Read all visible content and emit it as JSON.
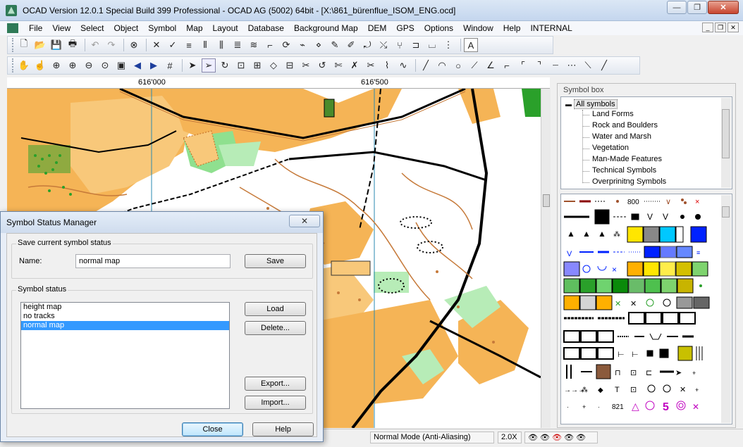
{
  "window": {
    "title": "OCAD Version 12.0.1  Special Build 399  Professional - OCAD AG (5002) 64bit - [X:\\861_bürenflue_ISOM_ENG.ocd]",
    "min_label": "—",
    "max_label": "❐",
    "close_label": "✕"
  },
  "menu": [
    "File",
    "View",
    "Select",
    "Object",
    "Symbol",
    "Map",
    "Layout",
    "Database",
    "Background Map",
    "DEM",
    "GPS",
    "Options",
    "Window",
    "Help",
    "INTERNAL"
  ],
  "ruler": {
    "labels": [
      "616'000",
      "616'500"
    ]
  },
  "symbol_box": {
    "title": "Symbol box",
    "tree_root": "All symbols",
    "tree_children": [
      "Land Forms",
      "Rock and Boulders",
      "Water and Marsh",
      "Vegetation",
      "Man-Made Features",
      "Technical Symbols",
      "Overprinitng Symbols"
    ],
    "palette_text": [
      "800",
      "821",
      "5"
    ]
  },
  "dialog": {
    "title": "Symbol Status Manager",
    "close_label": "✕",
    "save_group": "Save current symbol status",
    "name_label": "Name:",
    "name_value": "normal map",
    "save_button": "Save",
    "status_group": "Symbol status",
    "status_items": [
      "height map",
      "no tracks",
      "normal map"
    ],
    "selected_index": 2,
    "load_button": "Load",
    "delete_button": "Delete...",
    "export_button": "Export...",
    "import_button": "Import...",
    "close_button": "Close",
    "help_button": "Help"
  },
  "status": {
    "mode": "Normal Mode (Anti-Aliasing)",
    "zoom": "2.0X"
  },
  "colors": {
    "map_orange": "#f5b456",
    "map_green": "#8fe08f",
    "map_dark_green": "#2aa02a",
    "selection": "#3399ff"
  }
}
